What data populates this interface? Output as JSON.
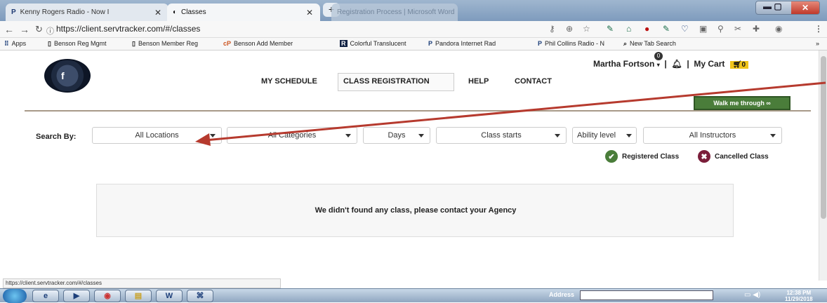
{
  "browser": {
    "tabs": [
      {
        "title": "Kenny Rogers Radio - Now I"
      },
      {
        "title": "Classes"
      },
      {
        "title": "Registration Process | Microsoft Word"
      }
    ],
    "url": "https://client.servtracker.com/#/classes",
    "status_url": "https://client.servtracker.com/#/classes",
    "bookmarks": [
      {
        "label": "Apps",
        "icon": "apps-grid-icon"
      },
      {
        "label": "Benson Reg Mgmt",
        "icon": "page-icon"
      },
      {
        "label": "Benson Member Reg",
        "icon": "page-icon"
      },
      {
        "label": "Benson Add Member",
        "icon": "cp-icon"
      },
      {
        "label": "Colorful Translucent",
        "icon": "r-icon"
      },
      {
        "label": "Pandora Internet Rad",
        "icon": "pandora-icon"
      },
      {
        "label": "Phil Collins Radio - N",
        "icon": "pandora-icon"
      },
      {
        "label": "New Tab Search",
        "icon": "search-icon"
      }
    ]
  },
  "header": {
    "user_name": "Martha Fortson",
    "bell_count": "0",
    "cart_label": "My Cart",
    "cart_count": "0",
    "nav": [
      {
        "label": "MY SCHEDULE"
      },
      {
        "label": "CLASS REGISTRATION"
      },
      {
        "label": "HELP"
      },
      {
        "label": "CONTACT"
      }
    ],
    "walk_button": "Walk me through"
  },
  "search": {
    "label": "Search By:",
    "filters": [
      {
        "value": "All Locations"
      },
      {
        "value": "All Categories"
      },
      {
        "value": "Days"
      },
      {
        "value": "Class starts"
      },
      {
        "value": "Ability level"
      },
      {
        "value": "All Instructors"
      }
    ]
  },
  "legend": {
    "registered": "Registered Class",
    "cancelled": "Cancelled Class"
  },
  "message": "We didn't found any class, please contact your Agency",
  "taskbar": {
    "address_label": "Address",
    "time": "12:38 PM",
    "date": "11/29/2018"
  },
  "colors": {
    "accent_green": "#4a7d3a",
    "cancel_maroon": "#7b1e3a",
    "arrow_red": "#b63a2e"
  }
}
